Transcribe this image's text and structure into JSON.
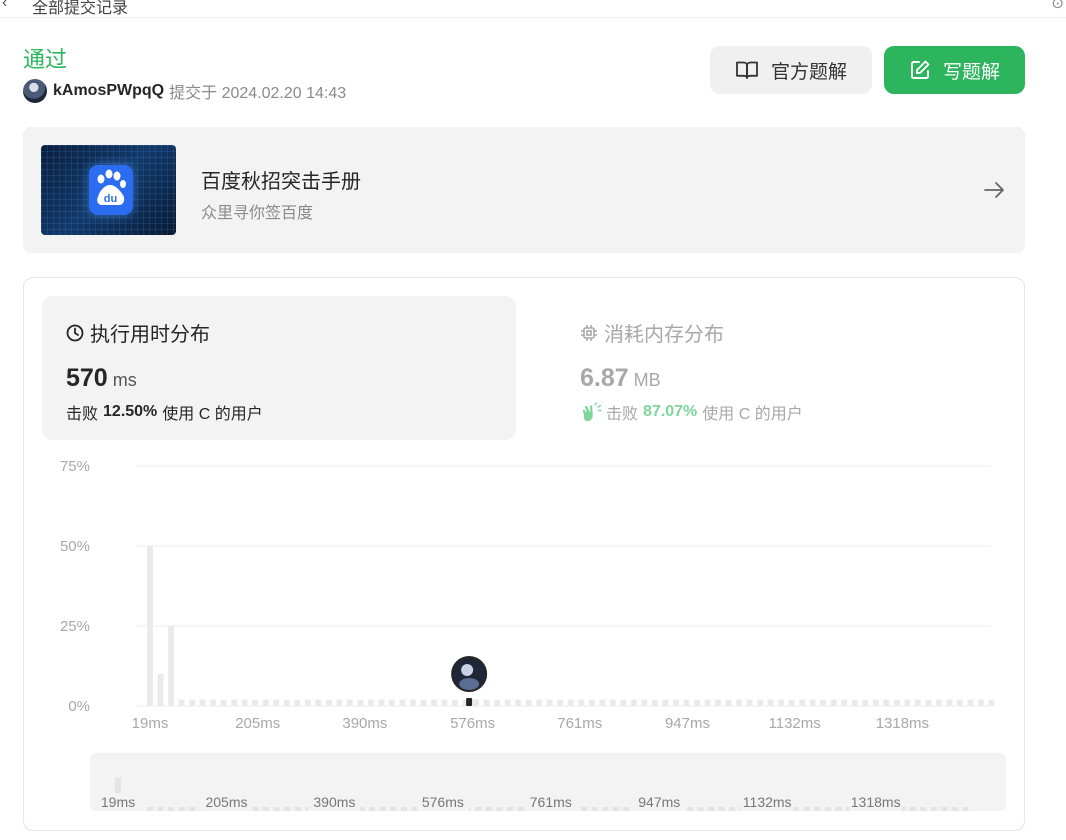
{
  "topbar": {
    "title": "全部提交记录"
  },
  "submission": {
    "status": "通过",
    "username": "kAmosPWpqQ",
    "submitted_text": "提交于 2024.02.20 14:43"
  },
  "actions": {
    "official_solution": "官方题解",
    "write_solution": "写题解"
  },
  "banner": {
    "title": "百度秋招突击手册",
    "subtitle": "众里寻你签百度",
    "logo_text": "du"
  },
  "runtime": {
    "title": "执行用时分布",
    "value": "570",
    "unit": "ms",
    "beats_prefix": "击败",
    "beats_pct": "12.50%",
    "beats_suffix": "使用 C 的用户"
  },
  "memory": {
    "title": "消耗内存分布",
    "value": "6.87",
    "unit": "MB",
    "beats_prefix": "击败",
    "beats_pct": "87.07%",
    "beats_suffix": "使用 C 的用户"
  },
  "colors": {
    "accent": "#2db55d",
    "bar": "#eaeaea",
    "grid": "#ececec",
    "marker": "#262626"
  },
  "chart_data": {
    "type": "bar",
    "title": "",
    "xlabel": "",
    "ylabel": "",
    "yticks": [
      "0%",
      "25%",
      "50%",
      "75%"
    ],
    "ylim": [
      0,
      75
    ],
    "xticks": [
      "19ms",
      "205ms",
      "390ms",
      "576ms",
      "761ms",
      "947ms",
      "1132ms",
      "1318ms"
    ],
    "x_range": [
      19,
      1490
    ],
    "bin_width": 18.6,
    "series": [
      {
        "values": [
          50,
          10,
          25,
          2,
          2,
          2,
          2,
          2,
          2,
          2,
          2,
          2,
          2,
          2,
          2,
          2,
          2,
          2,
          2,
          2,
          2,
          2,
          2,
          2,
          2,
          2,
          2,
          2,
          2,
          2,
          2,
          2,
          2,
          2,
          2,
          2,
          2,
          2,
          2,
          2,
          2,
          2,
          2,
          2,
          2,
          2,
          2,
          2,
          2,
          2,
          2,
          2,
          2,
          2,
          2,
          2,
          2,
          2,
          2,
          2,
          2,
          2,
          2,
          2,
          2,
          2,
          2,
          2,
          2,
          2,
          2,
          2,
          2,
          2,
          2,
          2,
          2,
          2,
          2,
          2,
          2
        ]
      }
    ],
    "current_value": 570,
    "grid": true
  }
}
